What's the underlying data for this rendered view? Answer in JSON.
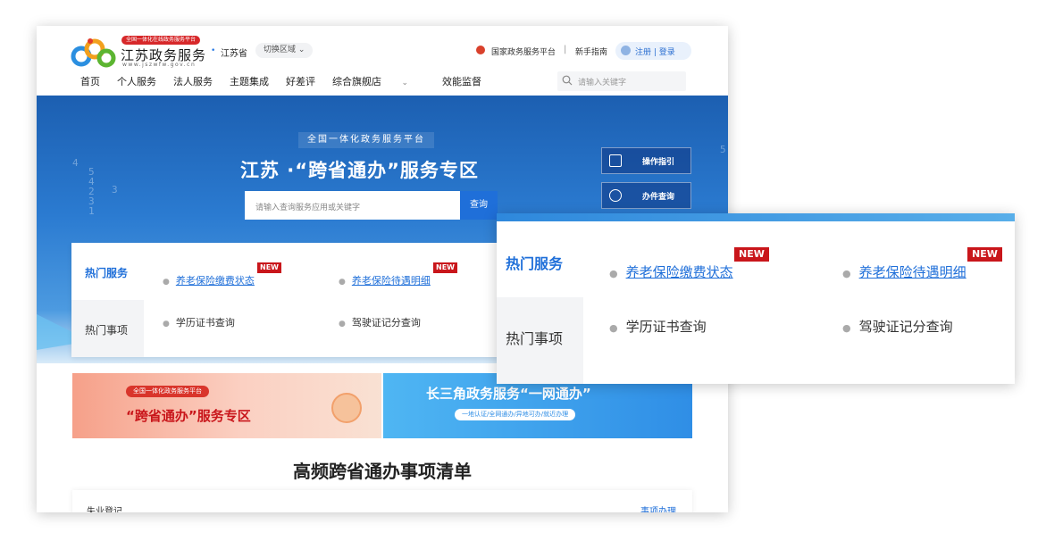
{
  "header": {
    "logo_tag": "全国一体化在线政务服务平台",
    "logo_title": "江苏政务服务",
    "logo_url": "www.jszwfw.gov.cn",
    "location": "江苏省",
    "switch_region": "切换区域",
    "national_link": "国家政务服务平台",
    "separator": "|",
    "guide_link": "新手指南",
    "login_text": "注册 | 登录",
    "search_placeholder": "请输入关键字"
  },
  "nav": {
    "items": [
      "首页",
      "个人服务",
      "法人服务",
      "主题集成",
      "好差评",
      "综合旗舰店",
      "效能监督"
    ]
  },
  "hero": {
    "subtitle": "全国一体化政务服务平台",
    "title": "江苏 ·“跨省通办”服务专区",
    "search_placeholder": "请输入查询服务应用或关键字",
    "search_button": "查询",
    "side_buttons": [
      "操作指引",
      "办件查询"
    ]
  },
  "hot": {
    "tab_services": "热门服务",
    "tab_matters": "热门事项",
    "services": [
      {
        "label": "养老保险缴费状态",
        "badge": "NEW"
      },
      {
        "label": "养老保险待遇明细",
        "badge": "NEW"
      }
    ],
    "matters": [
      {
        "label": "学历证书查询"
      },
      {
        "label": "驾驶证记分查询"
      }
    ]
  },
  "banners": {
    "left_tag": "全国一体化政务服务平台",
    "left_title": "“跨省通办”服务专区",
    "right_title": "长三角政务服务“一网通办”",
    "right_sub": "一地认证/全网通办/异地可办/就近办理"
  },
  "list": {
    "title": "高频跨省通办事项清单",
    "first_item": "失业登记",
    "first_action": "事项办理"
  },
  "colors": {
    "accent": "#1f6fd9",
    "badge": "#c9161b",
    "hero_top": "#1c5fb1"
  }
}
